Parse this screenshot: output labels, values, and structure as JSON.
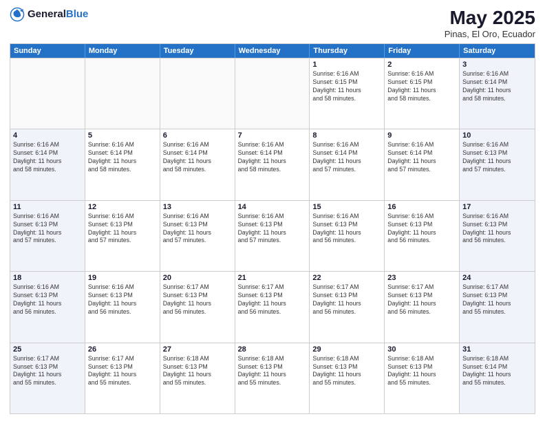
{
  "header": {
    "logo_general": "General",
    "logo_blue": "Blue",
    "title": "May 2025",
    "location": "Pinas, El Oro, Ecuador"
  },
  "weekdays": [
    "Sunday",
    "Monday",
    "Tuesday",
    "Wednesday",
    "Thursday",
    "Friday",
    "Saturday"
  ],
  "weeks": [
    [
      {
        "day": "",
        "info": "",
        "empty": true
      },
      {
        "day": "",
        "info": "",
        "empty": true
      },
      {
        "day": "",
        "info": "",
        "empty": true
      },
      {
        "day": "",
        "info": "",
        "empty": true
      },
      {
        "day": "1",
        "info": "Sunrise: 6:16 AM\nSunset: 6:15 PM\nDaylight: 11 hours\nand 58 minutes.",
        "empty": false,
        "shaded": false
      },
      {
        "day": "2",
        "info": "Sunrise: 6:16 AM\nSunset: 6:15 PM\nDaylight: 11 hours\nand 58 minutes.",
        "empty": false,
        "shaded": false
      },
      {
        "day": "3",
        "info": "Sunrise: 6:16 AM\nSunset: 6:14 PM\nDaylight: 11 hours\nand 58 minutes.",
        "empty": false,
        "shaded": true
      }
    ],
    [
      {
        "day": "4",
        "info": "Sunrise: 6:16 AM\nSunset: 6:14 PM\nDaylight: 11 hours\nand 58 minutes.",
        "empty": false,
        "shaded": true
      },
      {
        "day": "5",
        "info": "Sunrise: 6:16 AM\nSunset: 6:14 PM\nDaylight: 11 hours\nand 58 minutes.",
        "empty": false,
        "shaded": false
      },
      {
        "day": "6",
        "info": "Sunrise: 6:16 AM\nSunset: 6:14 PM\nDaylight: 11 hours\nand 58 minutes.",
        "empty": false,
        "shaded": false
      },
      {
        "day": "7",
        "info": "Sunrise: 6:16 AM\nSunset: 6:14 PM\nDaylight: 11 hours\nand 58 minutes.",
        "empty": false,
        "shaded": false
      },
      {
        "day": "8",
        "info": "Sunrise: 6:16 AM\nSunset: 6:14 PM\nDaylight: 11 hours\nand 57 minutes.",
        "empty": false,
        "shaded": false
      },
      {
        "day": "9",
        "info": "Sunrise: 6:16 AM\nSunset: 6:14 PM\nDaylight: 11 hours\nand 57 minutes.",
        "empty": false,
        "shaded": false
      },
      {
        "day": "10",
        "info": "Sunrise: 6:16 AM\nSunset: 6:13 PM\nDaylight: 11 hours\nand 57 minutes.",
        "empty": false,
        "shaded": true
      }
    ],
    [
      {
        "day": "11",
        "info": "Sunrise: 6:16 AM\nSunset: 6:13 PM\nDaylight: 11 hours\nand 57 minutes.",
        "empty": false,
        "shaded": true
      },
      {
        "day": "12",
        "info": "Sunrise: 6:16 AM\nSunset: 6:13 PM\nDaylight: 11 hours\nand 57 minutes.",
        "empty": false,
        "shaded": false
      },
      {
        "day": "13",
        "info": "Sunrise: 6:16 AM\nSunset: 6:13 PM\nDaylight: 11 hours\nand 57 minutes.",
        "empty": false,
        "shaded": false
      },
      {
        "day": "14",
        "info": "Sunrise: 6:16 AM\nSunset: 6:13 PM\nDaylight: 11 hours\nand 57 minutes.",
        "empty": false,
        "shaded": false
      },
      {
        "day": "15",
        "info": "Sunrise: 6:16 AM\nSunset: 6:13 PM\nDaylight: 11 hours\nand 56 minutes.",
        "empty": false,
        "shaded": false
      },
      {
        "day": "16",
        "info": "Sunrise: 6:16 AM\nSunset: 6:13 PM\nDaylight: 11 hours\nand 56 minutes.",
        "empty": false,
        "shaded": false
      },
      {
        "day": "17",
        "info": "Sunrise: 6:16 AM\nSunset: 6:13 PM\nDaylight: 11 hours\nand 56 minutes.",
        "empty": false,
        "shaded": true
      }
    ],
    [
      {
        "day": "18",
        "info": "Sunrise: 6:16 AM\nSunset: 6:13 PM\nDaylight: 11 hours\nand 56 minutes.",
        "empty": false,
        "shaded": true
      },
      {
        "day": "19",
        "info": "Sunrise: 6:16 AM\nSunset: 6:13 PM\nDaylight: 11 hours\nand 56 minutes.",
        "empty": false,
        "shaded": false
      },
      {
        "day": "20",
        "info": "Sunrise: 6:17 AM\nSunset: 6:13 PM\nDaylight: 11 hours\nand 56 minutes.",
        "empty": false,
        "shaded": false
      },
      {
        "day": "21",
        "info": "Sunrise: 6:17 AM\nSunset: 6:13 PM\nDaylight: 11 hours\nand 56 minutes.",
        "empty": false,
        "shaded": false
      },
      {
        "day": "22",
        "info": "Sunrise: 6:17 AM\nSunset: 6:13 PM\nDaylight: 11 hours\nand 56 minutes.",
        "empty": false,
        "shaded": false
      },
      {
        "day": "23",
        "info": "Sunrise: 6:17 AM\nSunset: 6:13 PM\nDaylight: 11 hours\nand 56 minutes.",
        "empty": false,
        "shaded": false
      },
      {
        "day": "24",
        "info": "Sunrise: 6:17 AM\nSunset: 6:13 PM\nDaylight: 11 hours\nand 55 minutes.",
        "empty": false,
        "shaded": true
      }
    ],
    [
      {
        "day": "25",
        "info": "Sunrise: 6:17 AM\nSunset: 6:13 PM\nDaylight: 11 hours\nand 55 minutes.",
        "empty": false,
        "shaded": true
      },
      {
        "day": "26",
        "info": "Sunrise: 6:17 AM\nSunset: 6:13 PM\nDaylight: 11 hours\nand 55 minutes.",
        "empty": false,
        "shaded": false
      },
      {
        "day": "27",
        "info": "Sunrise: 6:18 AM\nSunset: 6:13 PM\nDaylight: 11 hours\nand 55 minutes.",
        "empty": false,
        "shaded": false
      },
      {
        "day": "28",
        "info": "Sunrise: 6:18 AM\nSunset: 6:13 PM\nDaylight: 11 hours\nand 55 minutes.",
        "empty": false,
        "shaded": false
      },
      {
        "day": "29",
        "info": "Sunrise: 6:18 AM\nSunset: 6:13 PM\nDaylight: 11 hours\nand 55 minutes.",
        "empty": false,
        "shaded": false
      },
      {
        "day": "30",
        "info": "Sunrise: 6:18 AM\nSunset: 6:13 PM\nDaylight: 11 hours\nand 55 minutes.",
        "empty": false,
        "shaded": false
      },
      {
        "day": "31",
        "info": "Sunrise: 6:18 AM\nSunset: 6:14 PM\nDaylight: 11 hours\nand 55 minutes.",
        "empty": false,
        "shaded": true
      }
    ]
  ]
}
